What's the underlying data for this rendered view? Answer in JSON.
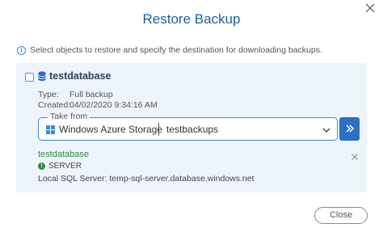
{
  "dialog": {
    "title": "Restore Backup",
    "info_text": "Select objects to restore and specify the destination for downloading backups.",
    "close_button_label": "Close"
  },
  "database": {
    "name": "testdatabase",
    "checked": false,
    "type_label": "Type:",
    "type_value": "Full backup",
    "created_label": "Created:",
    "created_value": "04/02/2020 9:34:16 AM"
  },
  "take_from": {
    "legend": "Take from",
    "storage_type": "Windows Azure Storage",
    "container": "testbackups"
  },
  "destination": {
    "database_name": "testdatabase",
    "server_label": "SERVER",
    "server_detail": "Local SQL Server: temp-sql-server.database.windows.net"
  },
  "colors": {
    "title": "#1e5f9e",
    "accent": "#2d6fc2",
    "panel_bg": "#eef4fb",
    "success": "#2e8b3e"
  },
  "icons": {
    "info": "info-icon",
    "database": "database-icon",
    "windows": "windows-logo-icon",
    "dropdown": "chevron-down-icon",
    "go": "double-chevron-right-icon",
    "remove": "close-icon",
    "server": "server-status-icon"
  }
}
